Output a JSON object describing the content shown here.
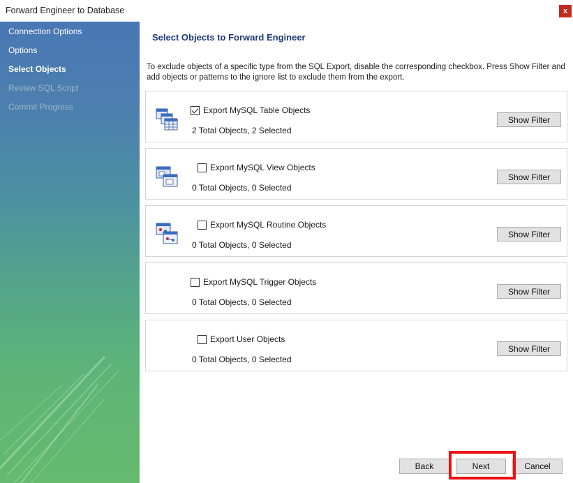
{
  "window": {
    "title": "Forward Engineer to Database",
    "close_glyph": "x"
  },
  "sidebar": {
    "items": [
      {
        "label": "Connection Options",
        "state": "normal"
      },
      {
        "label": "Options",
        "state": "normal"
      },
      {
        "label": "Select Objects",
        "state": "active"
      },
      {
        "label": "Review SQL Script",
        "state": "disabled"
      },
      {
        "label": "Commit Progress",
        "state": "disabled"
      }
    ]
  },
  "main": {
    "heading": "Select Objects to Forward Engineer",
    "description": "To exclude objects of a specific type from the SQL Export, disable the corresponding checkbox. Press Show Filter and add objects or patterns to the ignore list to exclude them from the export.",
    "panels": [
      {
        "checkbox_label": "Export MySQL Table Objects",
        "checked": true,
        "count_text": "2 Total Objects, 2 Selected",
        "button": "Show Filter",
        "icon": "table-objects-icon"
      },
      {
        "checkbox_label": "Export MySQL View Objects",
        "checked": false,
        "count_text": "0 Total Objects, 0 Selected",
        "button": "Show Filter",
        "icon": "view-objects-icon"
      },
      {
        "checkbox_label": "Export MySQL Routine Objects",
        "checked": false,
        "count_text": "0 Total Objects, 0 Selected",
        "button": "Show Filter",
        "icon": "routine-objects-icon"
      },
      {
        "checkbox_label": "Export MySQL Trigger Objects",
        "checked": false,
        "count_text": "0 Total Objects, 0 Selected",
        "button": "Show Filter",
        "icon": ""
      },
      {
        "checkbox_label": "Export User Objects",
        "checked": false,
        "count_text": "0 Total Objects, 0 Selected",
        "button": "Show Filter",
        "icon": ""
      }
    ]
  },
  "footer": {
    "back": "Back",
    "next": "Next",
    "cancel": "Cancel"
  },
  "colors": {
    "highlight": "#ee1111",
    "heading": "#1c3a78",
    "close": "#c42b1c"
  }
}
